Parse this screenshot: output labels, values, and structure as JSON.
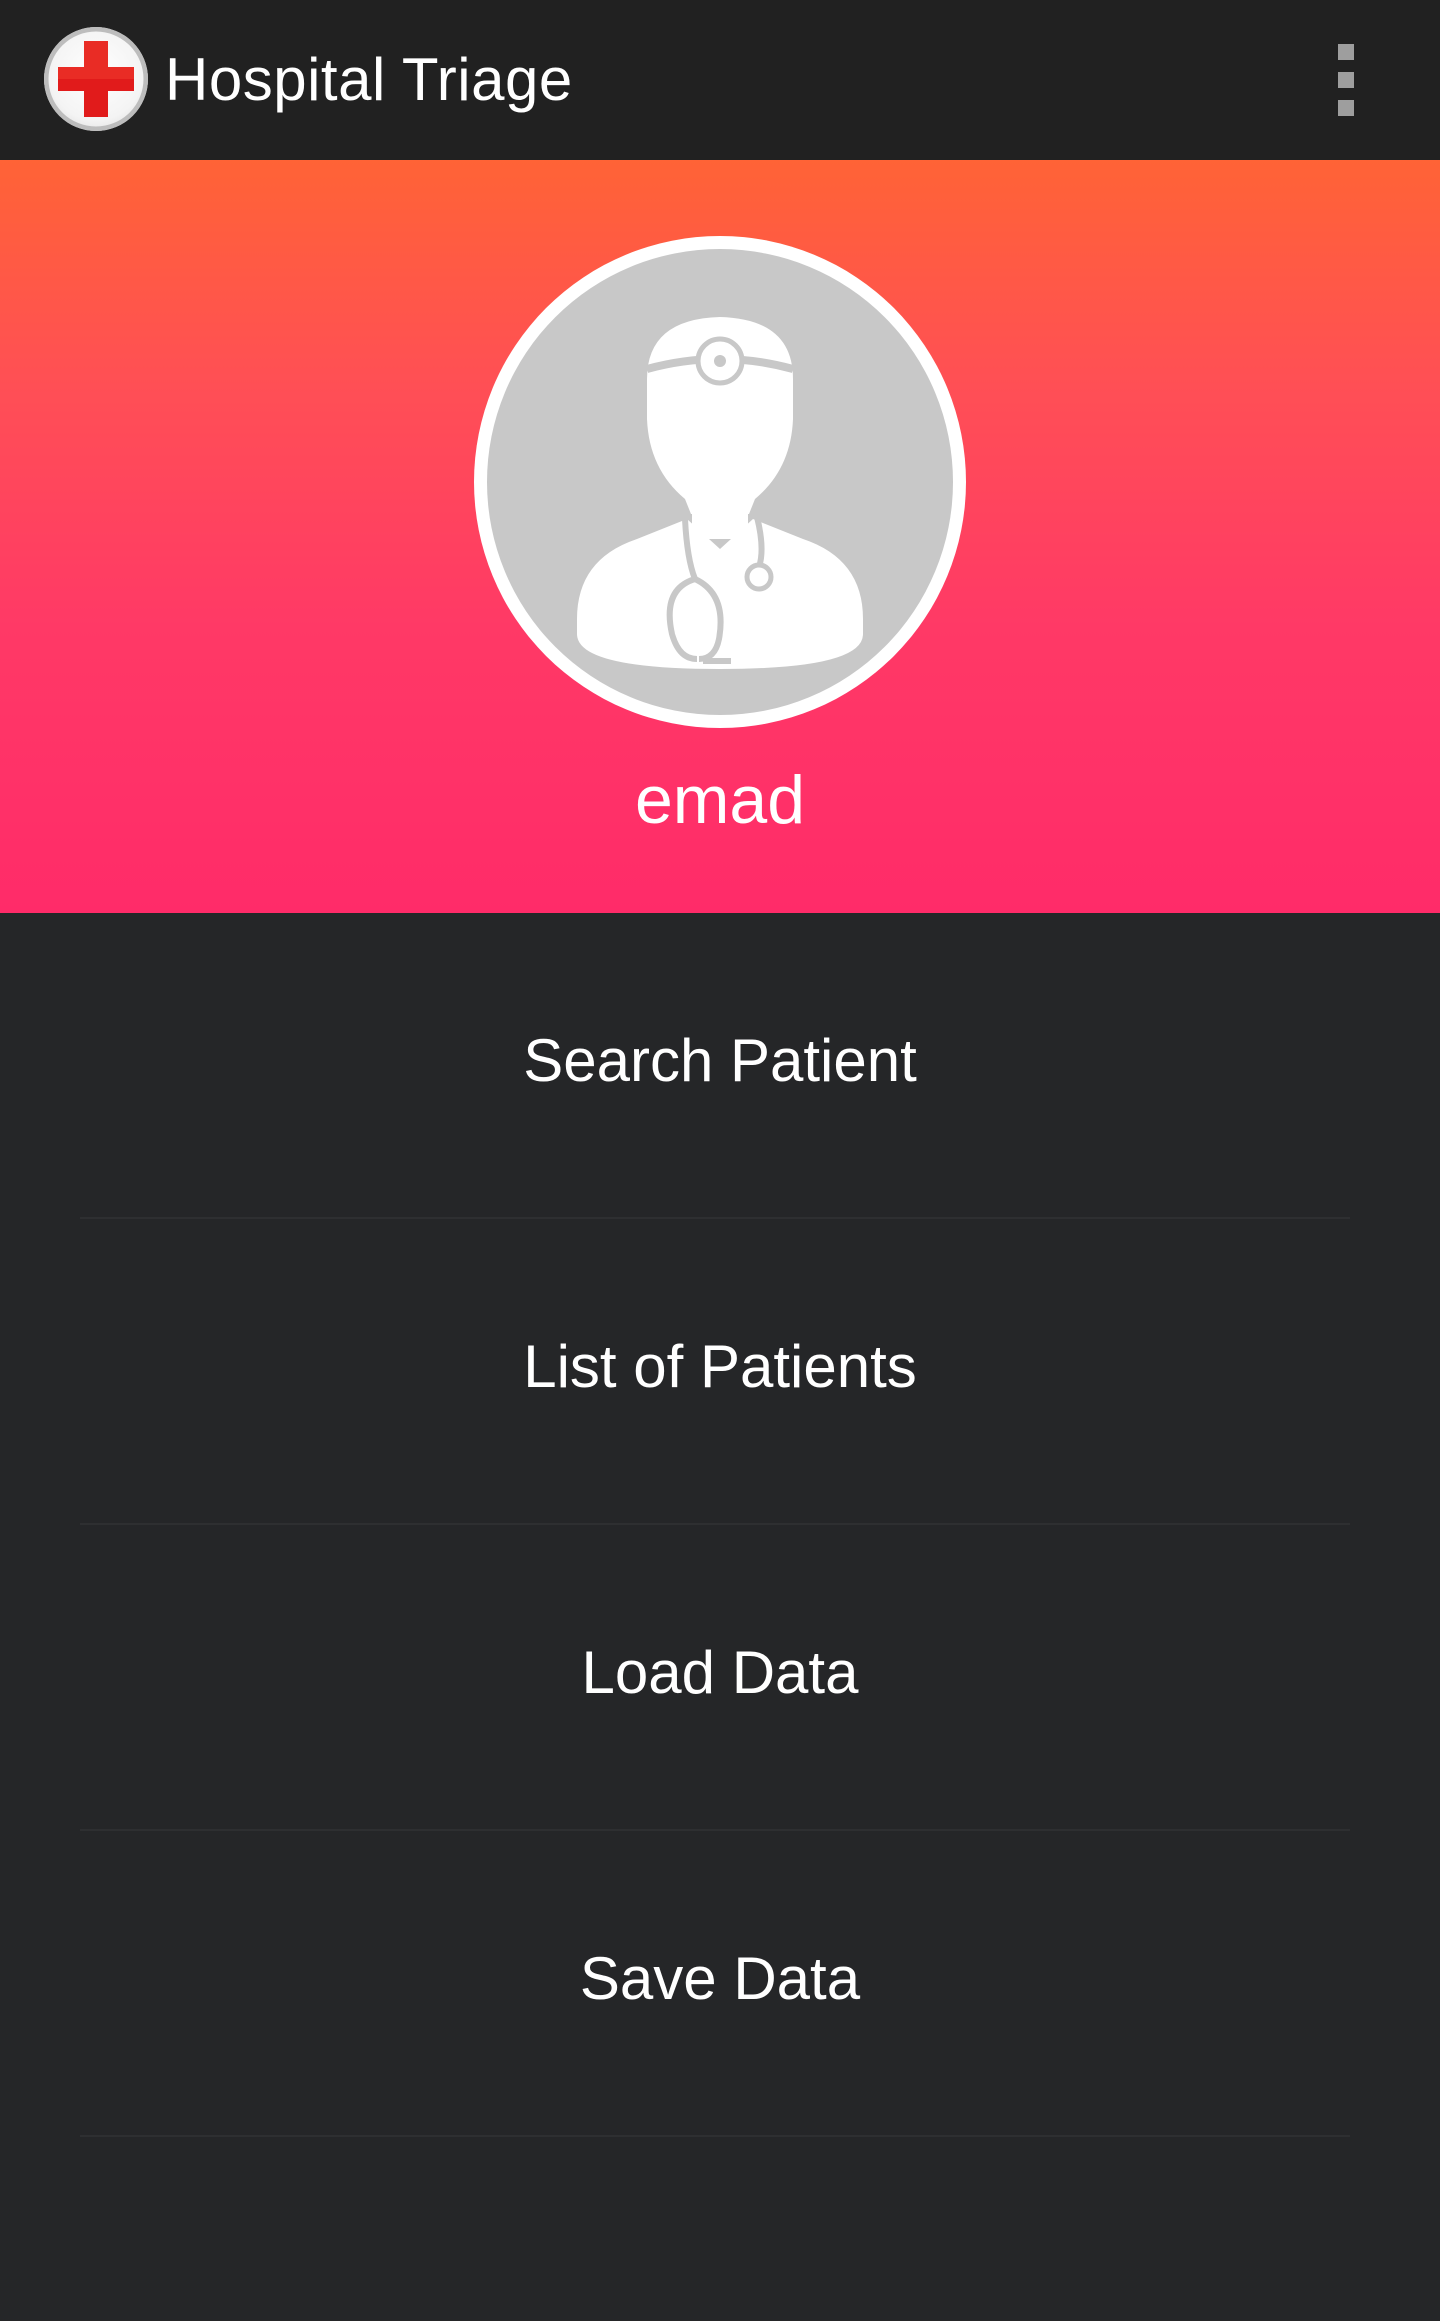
{
  "toolbar": {
    "title": "Hospital Triage",
    "logo_icon": "red-cross-icon",
    "overflow_icon": "more-vertical-icon"
  },
  "profile": {
    "avatar_icon": "doctor-avatar-icon",
    "username": "emad"
  },
  "menu": {
    "items": [
      {
        "label": "Search Patient"
      },
      {
        "label": "List of Patients"
      },
      {
        "label": "Load Data"
      },
      {
        "label": "Save Data"
      }
    ]
  },
  "colors": {
    "toolbar_bg": "#212121",
    "body_bg": "#252628",
    "gradient_top": "#ff6336",
    "gradient_bottom": "#ff2b69",
    "cross_red": "#e11b1b"
  }
}
